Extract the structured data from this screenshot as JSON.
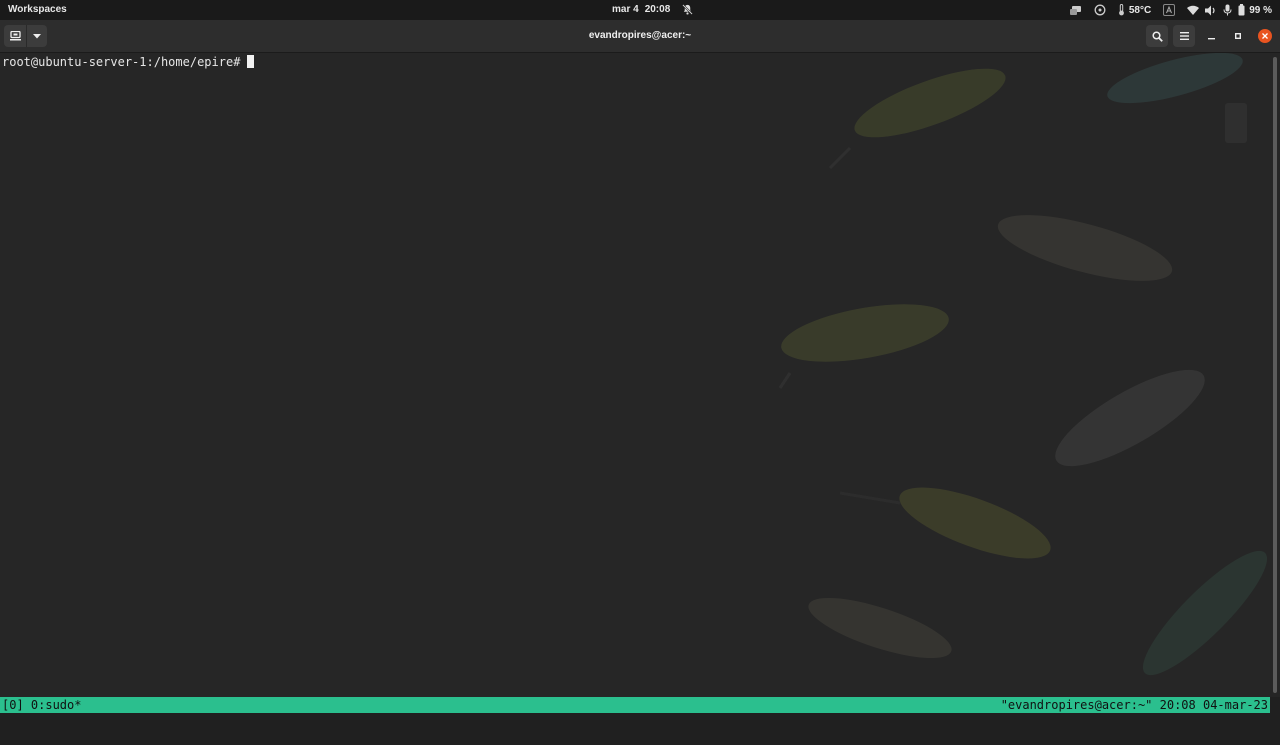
{
  "topbar": {
    "workspaces_label": "Workspaces",
    "date": "mar 4",
    "time": "20:08",
    "temperature": "58°C",
    "battery_percent": "99 %",
    "icons": [
      "notifications-off-icon",
      "network-tray-icon",
      "ubuntu-circle-icon",
      "thermometer-icon",
      "keyboard-indicator-icon",
      "wifi-icon",
      "volume-icon",
      "microphone-icon",
      "battery-icon"
    ]
  },
  "window": {
    "title": "evandropires@acer:~",
    "accent_color": "#e95420"
  },
  "terminal": {
    "prompt": "root@ubuntu-server-1:/home/epire#",
    "foreground": "#e6e6e6",
    "background": "#262626"
  },
  "tmux": {
    "left": "[0] 0:sudo*",
    "right": "\"evandropires@acer:~\" 20:08 04-mar-23",
    "color": "#2bbf8e"
  }
}
